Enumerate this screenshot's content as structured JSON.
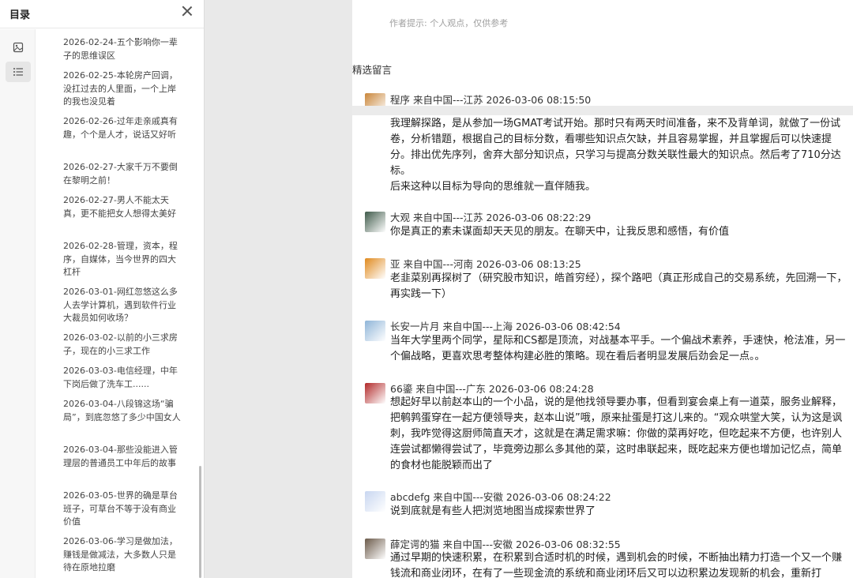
{
  "toc": {
    "title": "目录",
    "items": [
      "2026-02-24-五个影响你一辈子的思维误区",
      "2026-02-25-本轮房产回调，没扛过去的人里面，一个上岸的我也没见着",
      "2026-02-26-过年走亲戚真有趣，个个是人才，说话又好听",
      "2026-02-27-大家千万不要倒在黎明之前！",
      "2026-02-27-男人不能太天真，更不能把女人想得太美好",
      "2026-02-28-管理，资本，程序，自媒体，当今世界的四大杠杆",
      "2026-03-01-网红忽悠这么多人去学计算机，遇到软件行业大裁员如何收场？",
      "2026-03-02-以前的小三求房子，现在的小三求工作",
      "2026-03-03-电信经理，中年下岗后做了洗车工......",
      "2026-03-04-八段锦这场“骗局”，到底忽悠了多少中国女人",
      "2026-03-04-那些没能进入管理层的普通员工中年后的故事",
      "2026-03-05-世界的确是草台班子，可草台不等于没有商业价值",
      "2026-03-06-学习是做加法，赚钱是做减法，大多数人只是待在原地拉磨"
    ]
  },
  "main": {
    "author_hint": "作者提示: 个人观点，仅供参考",
    "section_title": "精选留言",
    "comments": [
      {
        "head": "程序 来自中国---江苏 2026-03-06 08:15:50",
        "body": [
          "我理解探路，是从参加一场GMAT考试开始。那时只有两天时间准备，来不及背单词，就做了一份试卷，分析错题，根据自己的目标分数，看哪些知识点欠缺，并且容易掌握，并且掌握后可以快速提分。排出优先序列，舍弃大部分知识点，只学习与提高分数关联性最大的知识点。然后考了710分达标。",
          "后来这种以目标为导向的思维就一直伴随我。"
        ]
      },
      {
        "head": "大观 来自中国---江苏 2026-03-06 08:22:29",
        "body": [
          "你是真正的素未谋面却天天见的朋友。在聊天中，让我反思和感悟，有价值"
        ]
      },
      {
        "head": "亚 来自中国---河南 2026-03-06 08:13:25",
        "body": [
          "老韭菜别再探树了（研究股市知识，皓首穷经），探个路吧（真正形成自己的交易系统，先回溯一下，再实践一下）"
        ]
      },
      {
        "head": "长安一片月 来自中国---上海 2026-03-06 08:42:54",
        "body": [
          "当年大学里两个同学，星际和CS都是顶流，对战基本平手。一个偏战术素养，手速快，枪法准，另一个偏战略，更喜欢思考整体构建必胜的策略。现在看后者明显发展后劲会足一点。。"
        ]
      },
      {
        "head": "66鎏 来自中国---广东 2026-03-06 08:24:28",
        "body": [
          "想起好早以前赵本山的一个小品，说的是他找领导要办事，但看到宴会桌上有一道菜，服务业解释，把鹌鹑蛋穿在一起方便领导夹，赵本山说”哦，原来扯蛋是打这儿来的。“观众哄堂大笑，认为这是讽刺，我咋觉得这厨师简直天才，这就是在满足需求嘛：你做的菜再好吃，但吃起来不方便，也许别人连尝试都懒得尝试了，毕竟旁边那么多其他的菜，这时串联起来，既吃起来方便也增加记忆点，简单的食材也能脱颖而出了"
        ]
      },
      {
        "head": "abcdefg 来自中国---安徽 2026-03-06 08:24:22",
        "body": [
          "说到底就是有些人把浏览地图当成探索世界了"
        ]
      },
      {
        "head": "薛定谔的猫 来自中国---安徽 2026-03-06 08:32:55",
        "body": [
          "通过早期的快速积累，在积累到合适时机的时候，遇到机会的时候，不断抽出精力打造一个又一个赚钱流和商业闭环，在有了一些现金流的系统和商业闭环后又可以边积累边发现新的机会，重新打"
        ]
      }
    ]
  },
  "colors": {
    "avatar_0": "#c9863a",
    "avatar_1": "#3f5a4a",
    "avatar_2": "#e08a1e",
    "avatar_3": "#8fb5d8",
    "avatar_4": "#b22a2a",
    "avatar_5": "#c8d6f0",
    "avatar_6": "#6b5a4a"
  }
}
